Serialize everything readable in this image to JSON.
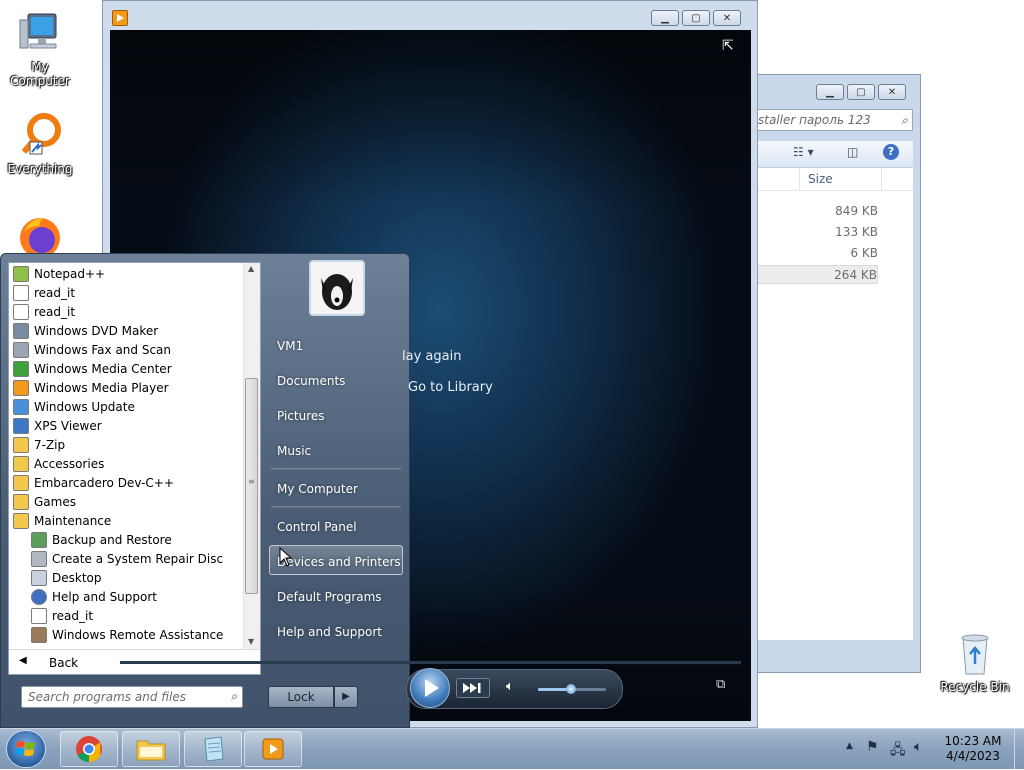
{
  "desktop": {
    "icons": [
      {
        "label": "My Computer"
      },
      {
        "label": "Everything"
      },
      {
        "label": "Recycle Bin"
      }
    ]
  },
  "explorer": {
    "search_placeholder": "staller пароль 123",
    "column_size": "Size",
    "rows": [
      "849 KB",
      "133 KB",
      "6 KB",
      "264 KB"
    ]
  },
  "media_player": {
    "play_again": "lay again",
    "go_to_library": "Go to Library"
  },
  "start_menu": {
    "programs": [
      {
        "label": "Notepad++",
        "icon": "notepad-plus-icon",
        "indent": 0
      },
      {
        "label": "read_it",
        "icon": "text-file-icon",
        "indent": 0
      },
      {
        "label": "read_it",
        "icon": "text-file-icon",
        "indent": 0
      },
      {
        "label": "Windows DVD Maker",
        "icon": "dvd-maker-icon",
        "indent": 0
      },
      {
        "label": "Windows Fax and Scan",
        "icon": "fax-icon",
        "indent": 0
      },
      {
        "label": "Windows Media Center",
        "icon": "media-center-icon",
        "indent": 0
      },
      {
        "label": "Windows Media Player",
        "icon": "media-player-icon",
        "indent": 0
      },
      {
        "label": "Windows Update",
        "icon": "windows-update-icon",
        "indent": 0
      },
      {
        "label": "XPS Viewer",
        "icon": "xps-viewer-icon",
        "indent": 0
      },
      {
        "label": "7-Zip",
        "icon": "folder-icon",
        "indent": 0
      },
      {
        "label": "Accessories",
        "icon": "folder-icon",
        "indent": 0
      },
      {
        "label": "Embarcadero Dev-C++",
        "icon": "folder-icon",
        "indent": 0
      },
      {
        "label": "Games",
        "icon": "folder-icon",
        "indent": 0
      },
      {
        "label": "Maintenance",
        "icon": "folder-icon",
        "indent": 0
      },
      {
        "label": "Backup and Restore",
        "icon": "backup-icon",
        "indent": 1
      },
      {
        "label": "Create a System Repair Disc",
        "icon": "repair-disc-icon",
        "indent": 1
      },
      {
        "label": "Desktop",
        "icon": "desktop-icon",
        "indent": 1
      },
      {
        "label": "Help and Support",
        "icon": "help-icon",
        "indent": 1
      },
      {
        "label": "read_it",
        "icon": "text-file-icon",
        "indent": 1
      },
      {
        "label": "Windows Remote Assistance",
        "icon": "remote-assistance-icon",
        "indent": 1
      }
    ],
    "back_label": "Back",
    "search_placeholder": "Search programs and files",
    "right_items": [
      {
        "label": "VM1",
        "name": "user-name-link"
      },
      {
        "label": "Documents",
        "name": "documents-link"
      },
      {
        "label": "Pictures",
        "name": "pictures-link"
      },
      {
        "label": "Music",
        "name": "music-link"
      },
      {
        "label": "My Computer",
        "name": "my-computer-link"
      },
      {
        "label": "Control Panel",
        "name": "control-panel-link"
      },
      {
        "label": "Devices and Printers",
        "name": "devices-and-printers-link"
      },
      {
        "label": "Default Programs",
        "name": "default-programs-link"
      },
      {
        "label": "Help and Support",
        "name": "help-and-support-link"
      }
    ],
    "lock_label": "Lock"
  },
  "taskbar": {
    "time": "10:23 AM",
    "date": "4/4/2023"
  },
  "colors": {
    "taskbar": "#8aa2bd",
    "start_menu": "#4a5d75",
    "media_background": "#123454"
  }
}
